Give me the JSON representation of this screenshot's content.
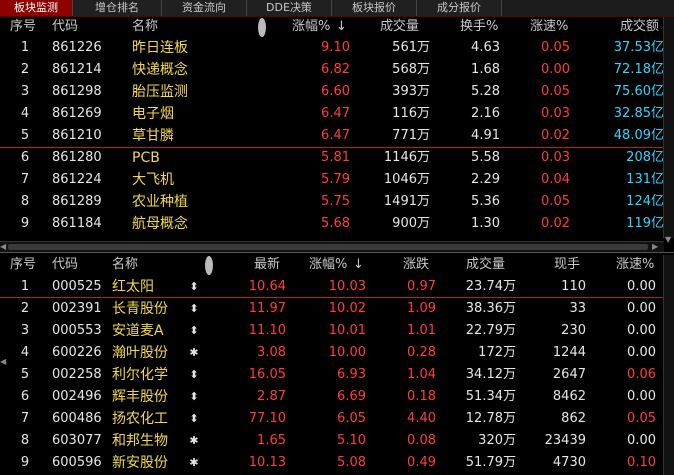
{
  "tabs": [
    "板块监测",
    "增仓排名",
    "资金流向",
    "DDE决策",
    "板块报价",
    "成分报价"
  ],
  "sector_table": {
    "headers": {
      "idx": "序号",
      "code": "代码",
      "name": "名称",
      "change_pct": "涨幅%",
      "volume": "成交量",
      "turnover": "换手%",
      "speed": "涨速%",
      "amount": "成交额"
    },
    "rows": [
      {
        "idx": "1",
        "code": "861226",
        "name": "昨日连板",
        "change_pct": "9.10",
        "volume": "561万",
        "turnover": "4.63",
        "speed": "0.05",
        "amount": "37.53亿"
      },
      {
        "idx": "2",
        "code": "861214",
        "name": "快递概念",
        "change_pct": "6.82",
        "volume": "568万",
        "turnover": "1.68",
        "speed": "0.00",
        "amount": "72.18亿"
      },
      {
        "idx": "3",
        "code": "861298",
        "name": "胎压监测",
        "change_pct": "6.60",
        "volume": "393万",
        "turnover": "5.28",
        "speed": "0.05",
        "amount": "75.60亿"
      },
      {
        "idx": "4",
        "code": "861269",
        "name": "电子烟",
        "change_pct": "6.47",
        "volume": "116万",
        "turnover": "2.16",
        "speed": "0.03",
        "amount": "32.85亿"
      },
      {
        "idx": "5",
        "code": "861210",
        "name": "草甘膦",
        "change_pct": "6.47",
        "volume": "771万",
        "turnover": "4.91",
        "speed": "0.02",
        "amount": "48.09亿"
      },
      {
        "idx": "6",
        "code": "861280",
        "name": "PCB",
        "change_pct": "5.81",
        "volume": "1146万",
        "turnover": "5.58",
        "speed": "0.03",
        "amount": "208亿"
      },
      {
        "idx": "7",
        "code": "861224",
        "name": "大飞机",
        "change_pct": "5.79",
        "volume": "1046万",
        "turnover": "2.29",
        "speed": "0.04",
        "amount": "131亿"
      },
      {
        "idx": "8",
        "code": "861289",
        "name": "农业种植",
        "change_pct": "5.75",
        "volume": "1491万",
        "turnover": "5.36",
        "speed": "0.05",
        "amount": "124亿"
      },
      {
        "idx": "9",
        "code": "861184",
        "name": "航母概念",
        "change_pct": "5.68",
        "volume": "900万",
        "turnover": "1.30",
        "speed": "0.02",
        "amount": "119亿"
      }
    ]
  },
  "stock_table": {
    "headers": {
      "idx": "序号",
      "code": "代码",
      "name": "名称",
      "price": "最新",
      "change_pct": "涨幅%",
      "change": "涨跌",
      "volume": "成交量",
      "hand": "现手",
      "speed": "涨速%"
    },
    "rows": [
      {
        "idx": "1",
        "code": "000525",
        "name": "红太阳",
        "mark": "⬍",
        "price": "10.64",
        "change_pct": "10.03",
        "change": "0.97",
        "volume": "23.74万",
        "hand": "110",
        "speed": "0.00"
      },
      {
        "idx": "2",
        "code": "002391",
        "name": "长青股份",
        "mark": "⬍",
        "price": "11.97",
        "change_pct": "10.02",
        "change": "1.09",
        "volume": "38.36万",
        "hand": "33",
        "speed": "0.00"
      },
      {
        "idx": "3",
        "code": "000553",
        "name": "安道麦A",
        "mark": "⬍",
        "price": "11.10",
        "change_pct": "10.01",
        "change": "1.01",
        "volume": "22.79万",
        "hand": "230",
        "speed": "0.00"
      },
      {
        "idx": "4",
        "code": "600226",
        "name": "瀚叶股份",
        "mark": "✱",
        "price": "3.08",
        "change_pct": "10.00",
        "change": "0.28",
        "volume": "172万",
        "hand": "1244",
        "speed": "0.00"
      },
      {
        "idx": "5",
        "code": "002258",
        "name": "利尔化学",
        "mark": "⬍",
        "price": "16.05",
        "change_pct": "6.93",
        "change": "1.04",
        "volume": "34.12万",
        "hand": "2647",
        "speed": "0.06"
      },
      {
        "idx": "6",
        "code": "002496",
        "name": "辉丰股份",
        "mark": "⬍",
        "price": "2.87",
        "change_pct": "6.69",
        "change": "0.18",
        "volume": "51.34万",
        "hand": "8462",
        "speed": "0.00"
      },
      {
        "idx": "7",
        "code": "600486",
        "name": "扬农化工",
        "mark": "⬍",
        "price": "77.10",
        "change_pct": "6.05",
        "change": "4.40",
        "volume": "12.78万",
        "hand": "862",
        "speed": "0.05"
      },
      {
        "idx": "8",
        "code": "603077",
        "name": "和邦生物",
        "mark": "✱",
        "price": "1.65",
        "change_pct": "5.10",
        "change": "0.08",
        "volume": "320万",
        "hand": "23439",
        "speed": "0.00"
      },
      {
        "idx": "9",
        "code": "600596",
        "name": "新安股份",
        "mark": "✱",
        "price": "10.13",
        "change_pct": "5.08",
        "change": "0.49",
        "volume": "51.79万",
        "hand": "4730",
        "speed": "0.10"
      }
    ]
  },
  "icons": {
    "sort": "sort-down-arrow-icon",
    "column_ctrl": "column-dot-icon"
  },
  "colors": {
    "up": "#ff3c3c",
    "name": "#f2d94b",
    "amount": "#2fd6ff",
    "tab_active": "#8c0000"
  }
}
